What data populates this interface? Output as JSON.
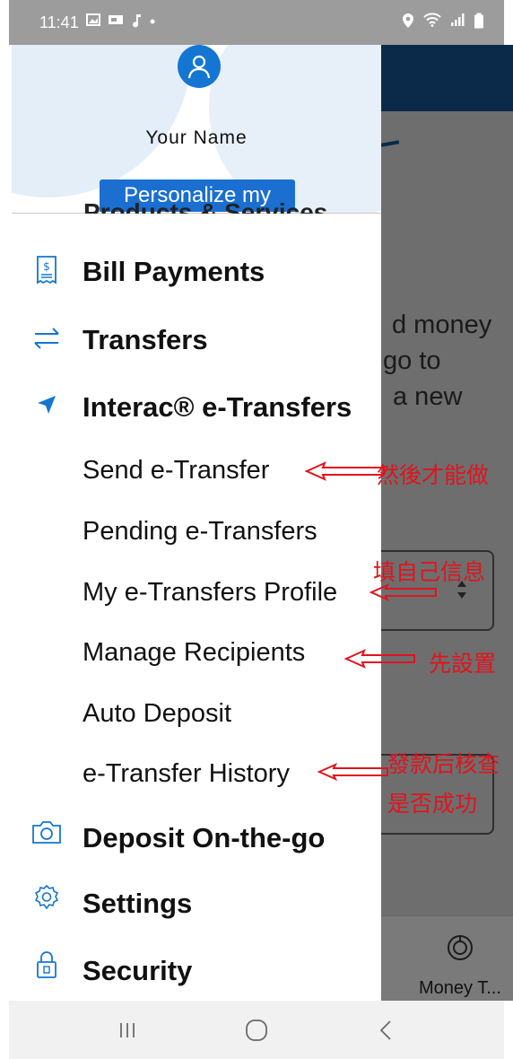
{
  "status_bar": {
    "time": "11:41",
    "left_icons": [
      "gallery-icon",
      "sim-icon",
      "music-icon",
      "dot-icon"
    ],
    "right_icons": [
      "location-icon",
      "wifi-icon",
      "signal-icon",
      "battery-icon"
    ]
  },
  "drawer": {
    "profile_name": "Your  Name",
    "personalize_label": "Personalize my",
    "peek_label": "Products & Services",
    "items": [
      {
        "label": "Bill Payments",
        "icon": "bill-icon"
      },
      {
        "label": "Transfers",
        "icon": "transfer-arrows-icon"
      },
      {
        "label": "Interac® e-Transfers",
        "icon": "send-arrow-icon"
      },
      {
        "label": "Deposit On-the-go",
        "icon": "camera-icon"
      },
      {
        "label": "Settings",
        "icon": "gear-icon"
      },
      {
        "label": "Security",
        "icon": "lock-icon"
      }
    ],
    "sub_items": [
      {
        "label": "Send e-Transfer"
      },
      {
        "label": "Pending e-Transfers"
      },
      {
        "label": "My e-Transfers Profile"
      },
      {
        "label": "Manage Recipients"
      },
      {
        "label": "Auto Deposit"
      },
      {
        "label": "e-Transfer History"
      }
    ]
  },
  "background": {
    "text_lines": [
      "d money",
      "go to",
      "a new"
    ],
    "money_label": "Money T..."
  },
  "annotations": {
    "send": "然後才能做",
    "profile": "填自己信息",
    "recipients": "先設置",
    "history_1": "發款后核查",
    "history_2": "是否成功"
  },
  "colors": {
    "accent": "#1a6fd1",
    "icon_blue": "#1476d2",
    "annotation_red": "#e0141e",
    "status_bar": "#9c9c9c"
  }
}
